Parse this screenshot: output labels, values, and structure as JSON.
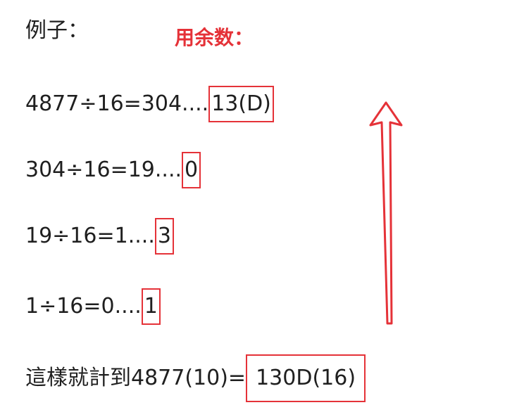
{
  "heading": "例子：",
  "annotation": "用余数：",
  "rows": [
    {
      "expr": "4877÷16=304....",
      "remainder": "13(D)"
    },
    {
      "expr": "304÷16=19....",
      "remainder": "0"
    },
    {
      "expr": "19÷16=1....",
      "remainder": "3"
    },
    {
      "expr": "1÷16=0....",
      "remainder": "1"
    }
  ],
  "conclusion": {
    "text": "這樣就計到4877(10)=",
    "result": "130D(16)"
  },
  "colors": {
    "accent": "#e53238",
    "text": "#1f1f1f"
  },
  "icons": {
    "arrow": "up-arrow-icon"
  }
}
